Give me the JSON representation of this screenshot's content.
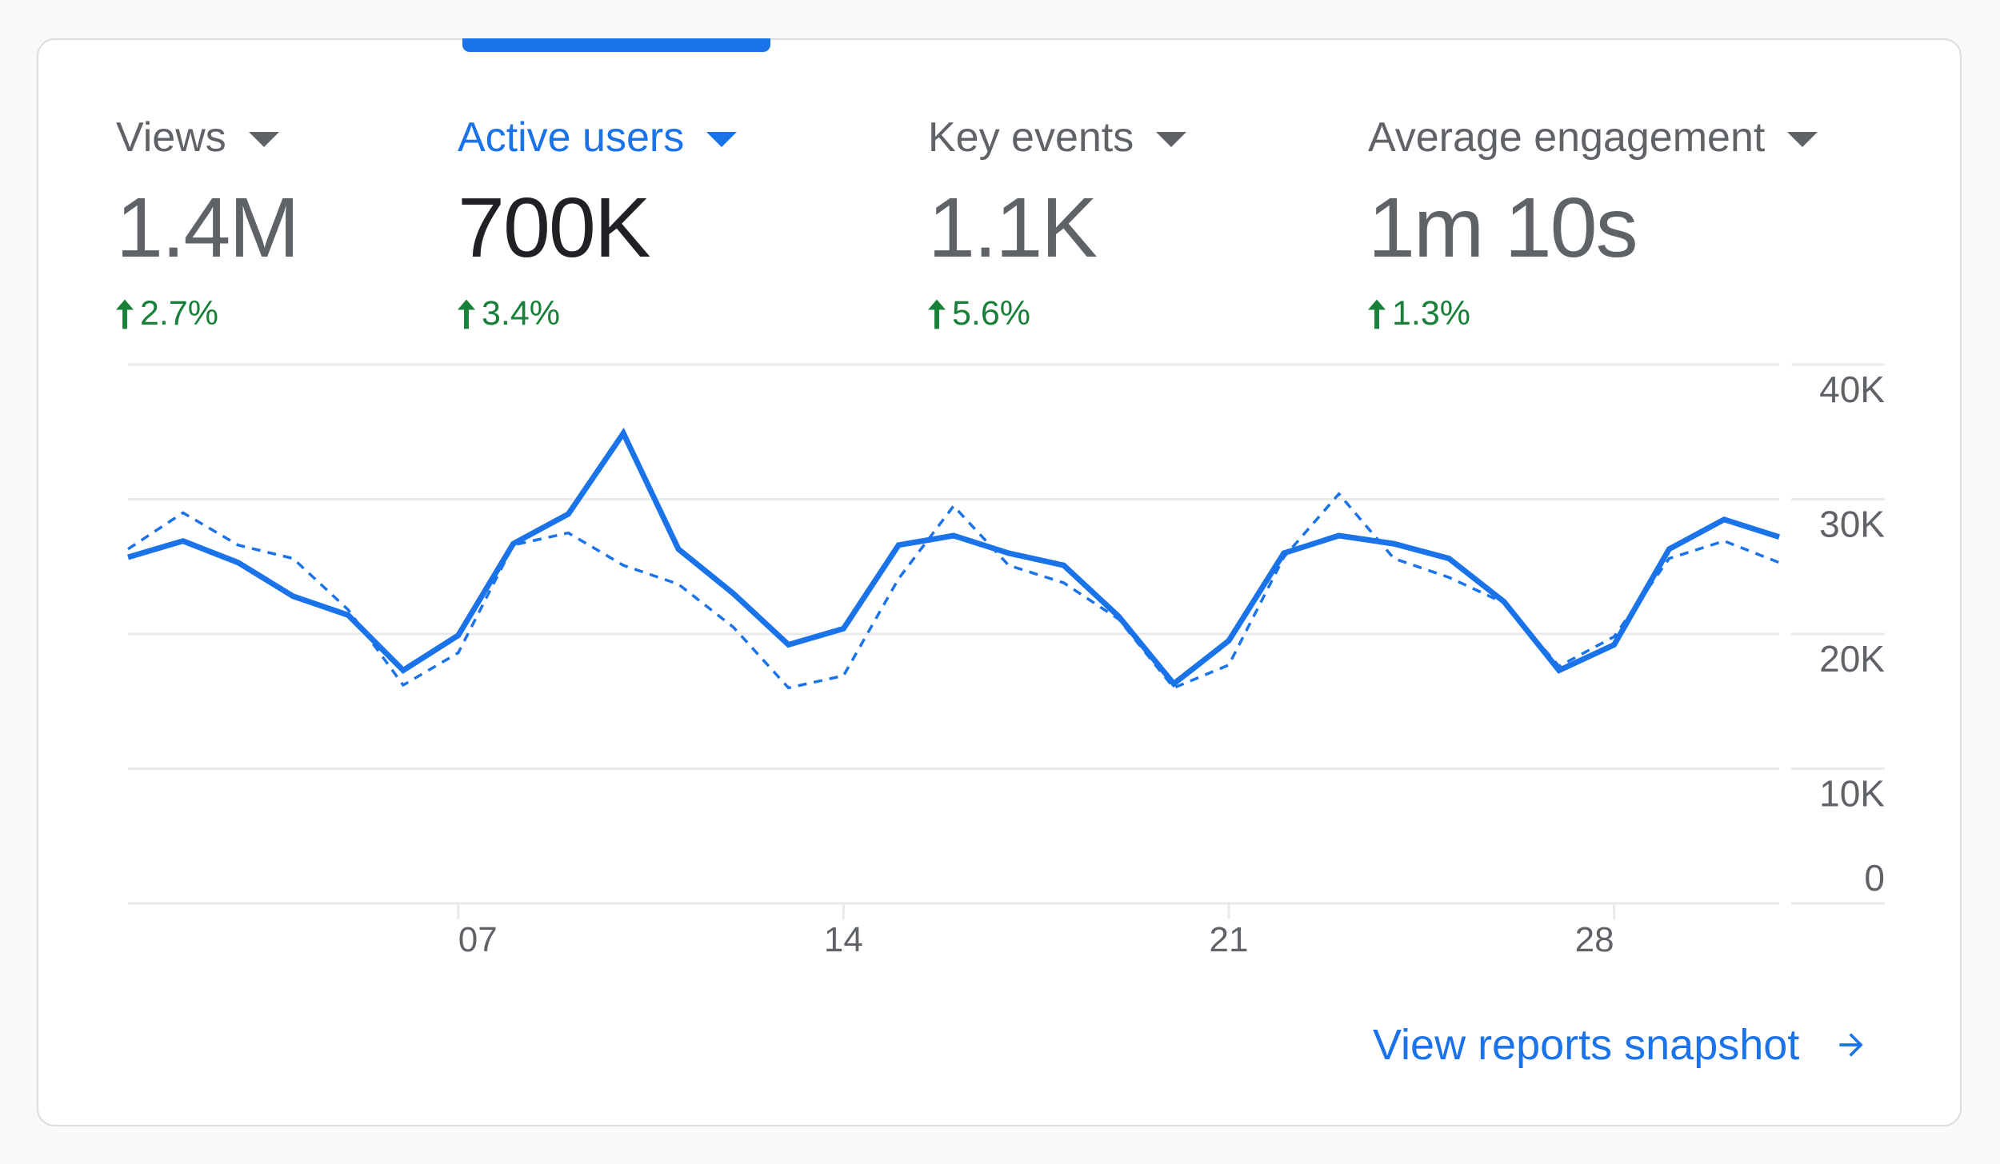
{
  "metrics": [
    {
      "label": "Views",
      "value": "1.4M",
      "delta": "2.7%",
      "direction": "up",
      "active": false
    },
    {
      "label": "Active users",
      "value": "700K",
      "delta": "3.4%",
      "direction": "up",
      "active": true
    },
    {
      "label": "Key events",
      "value": "1.1K",
      "delta": "5.6%",
      "direction": "up",
      "active": false
    },
    {
      "label": "Average engagement",
      "value": "1m 10s",
      "delta": "1.3%",
      "direction": "up",
      "active": false
    }
  ],
  "colors": {
    "accent": "#1a73e8",
    "positive": "#188038",
    "text_secondary": "#5f6368",
    "text_primary": "#202124",
    "gridline": "#e8eaed"
  },
  "footer": {
    "link_label": "View reports snapshot",
    "icon": "arrow-right-icon"
  },
  "chart_data": {
    "type": "line",
    "title": "",
    "xlabel": "",
    "ylabel": "",
    "x": [
      1,
      2,
      3,
      4,
      5,
      6,
      7,
      8,
      9,
      10,
      11,
      12,
      13,
      14,
      15,
      16,
      17,
      18,
      19,
      20,
      21,
      22,
      23,
      24,
      25,
      26,
      27,
      28,
      29,
      30,
      31
    ],
    "x_tick_labels": [
      {
        "day": 7,
        "label": "07",
        "align": "start"
      },
      {
        "day": 14,
        "label": "14",
        "align": "middle"
      },
      {
        "day": 21,
        "label": "21",
        "align": "middle"
      },
      {
        "day": 28,
        "label": "28",
        "align": "end"
      }
    ],
    "ylim": [
      0,
      40000
    ],
    "y_ticks": [
      {
        "value": 40000,
        "label": "40K"
      },
      {
        "value": 30000,
        "label": "30K"
      },
      {
        "value": 20000,
        "label": "20K"
      },
      {
        "value": 10000,
        "label": "10K"
      },
      {
        "value": 0,
        "label": "0"
      }
    ],
    "y_axis_position": "right",
    "grid": true,
    "series": [
      {
        "name": "Active users (current period)",
        "style": "solid",
        "color": "#1a73e8",
        "values": [
          25700,
          26900,
          25300,
          22800,
          21400,
          17300,
          19900,
          26700,
          28900,
          34900,
          26300,
          23000,
          19200,
          20400,
          26600,
          27300,
          26000,
          25100,
          21300,
          16300,
          19500,
          26000,
          27300,
          26700,
          25600,
          22400,
          17300,
          19200,
          26300,
          28500,
          27200
        ]
      },
      {
        "name": "Active users (previous period)",
        "style": "dashed",
        "color": "#1a73e8",
        "values": [
          26300,
          29000,
          26600,
          25600,
          21800,
          16200,
          18600,
          26600,
          27500,
          25100,
          23700,
          20500,
          16000,
          16900,
          24100,
          29500,
          25100,
          23800,
          21100,
          16000,
          17700,
          25700,
          30400,
          25600,
          24200,
          22300,
          17600,
          19800,
          25600,
          26900,
          25300
        ]
      }
    ]
  }
}
